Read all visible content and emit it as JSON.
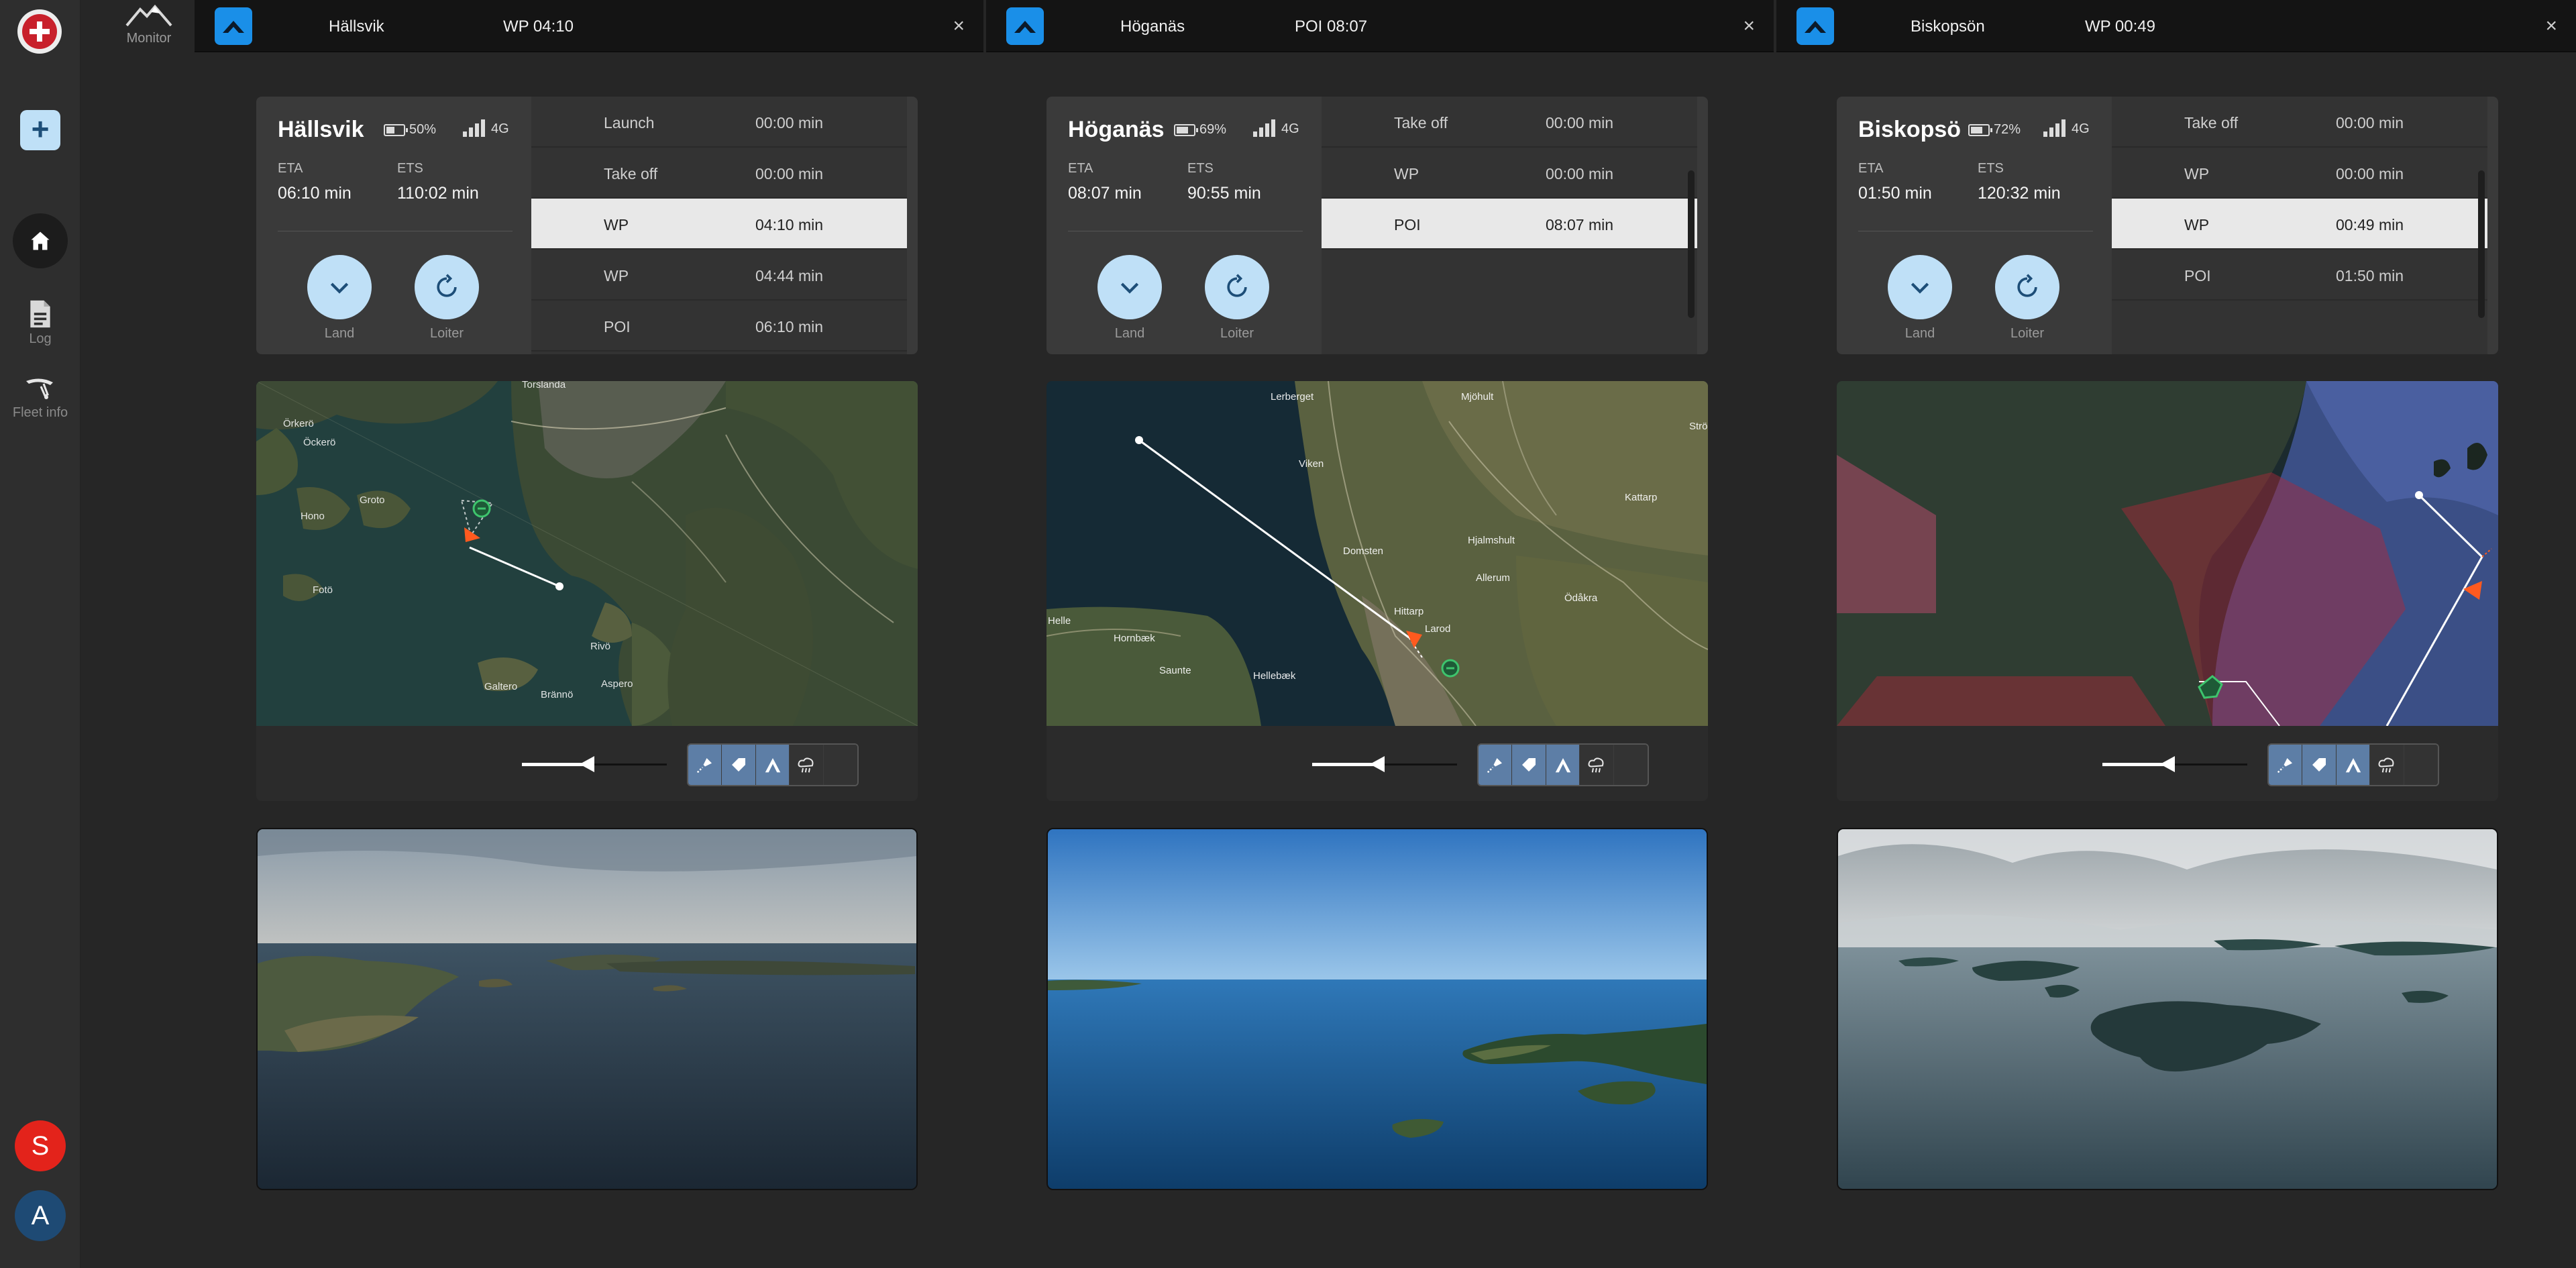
{
  "sidebar": {
    "logo_icon": "red-cross-logo",
    "add_label": "+",
    "items": [
      {
        "label": "",
        "icon": "home-icon"
      },
      {
        "label": "Log",
        "icon": "document-icon"
      },
      {
        "label": "Fleet info",
        "icon": "drone-icon"
      }
    ],
    "avatars": [
      "S",
      "A"
    ]
  },
  "topbar": {
    "monitor_label": "Monitor",
    "tabs": [
      {
        "name": "Hällsvik",
        "status": "WP 04:10",
        "close": "×"
      },
      {
        "name": "Höganäs",
        "status": "POI 08:07",
        "close": "×"
      },
      {
        "name": "Biskopsön",
        "status": "WP 00:49",
        "close": "×"
      }
    ]
  },
  "drones": [
    {
      "name": "Hällsvik",
      "battery": "50%",
      "battery_level": 0.5,
      "network": "4G",
      "eta_label": "ETA",
      "eta": "06:10 min",
      "ets_label": "ETS",
      "ets": "110:02 min",
      "land_label": "Land",
      "loiter_label": "Loiter",
      "waypoints": [
        {
          "label": "Launch",
          "time": "00:00 min",
          "active": false
        },
        {
          "label": "Take off",
          "time": "00:00 min",
          "active": false
        },
        {
          "label": "WP",
          "time": "04:10 min",
          "active": true
        },
        {
          "label": "WP",
          "time": "04:44 min",
          "active": false
        },
        {
          "label": "POI",
          "time": "06:10 min",
          "active": false
        }
      ],
      "map_labels": [
        "Torslanda",
        "Örkerö",
        "Öckerö",
        "Groto",
        "Hono",
        "Fotö",
        "Rivö",
        "Galtero",
        "Brännö",
        "Aspero"
      ]
    },
    {
      "name": "Höganäs",
      "battery": "69%",
      "battery_level": 0.69,
      "network": "4G",
      "eta_label": "ETA",
      "eta": "08:07 min",
      "ets_label": "ETS",
      "ets": "90:55 min",
      "land_label": "Land",
      "loiter_label": "Loiter",
      "waypoints": [
        {
          "label": "Take off",
          "time": "00:00 min",
          "active": false
        },
        {
          "label": "WP",
          "time": "00:00 min",
          "active": false
        },
        {
          "label": "POI",
          "time": "08:07 min",
          "active": true
        }
      ],
      "map_labels": [
        "Lerberget",
        "Mjöhult",
        "Viken",
        "Strö",
        "Kattarp",
        "Hjalmshult",
        "Domsten",
        "Allerum",
        "Ödåkra",
        "Hittarp",
        "Larod",
        "Hornbæk",
        "Saunte",
        "Hellebæk",
        "Helle"
      ]
    },
    {
      "name": "Biskopsö",
      "battery": "72%",
      "battery_level": 0.72,
      "network": "4G",
      "eta_label": "ETA",
      "eta": "01:50 min",
      "ets_label": "ETS",
      "ets": "120:32 min",
      "land_label": "Land",
      "loiter_label": "Loiter",
      "waypoints": [
        {
          "label": "Take off",
          "time": "00:00 min",
          "active": false
        },
        {
          "label": "WP",
          "time": "00:00 min",
          "active": false
        },
        {
          "label": "WP",
          "time": "00:49 min",
          "active": true
        },
        {
          "label": "POI",
          "time": "01:50 min",
          "active": false
        }
      ],
      "map_labels": []
    }
  ],
  "map_tools": [
    {
      "icon": "waypoint-pen-icon",
      "active": true
    },
    {
      "icon": "tag-icon",
      "active": true
    },
    {
      "icon": "terrain-icon",
      "active": true
    },
    {
      "icon": "weather-rain-icon",
      "active": false
    },
    {
      "icon": "empty-slot",
      "active": false
    }
  ],
  "colors": {
    "accent_blue": "#1a8fe8",
    "button_light_blue": "#bfe0f7",
    "route_orange": "#ff5a1f",
    "marker_green": "#3ec46d",
    "nofly_red": "#b0283a"
  }
}
